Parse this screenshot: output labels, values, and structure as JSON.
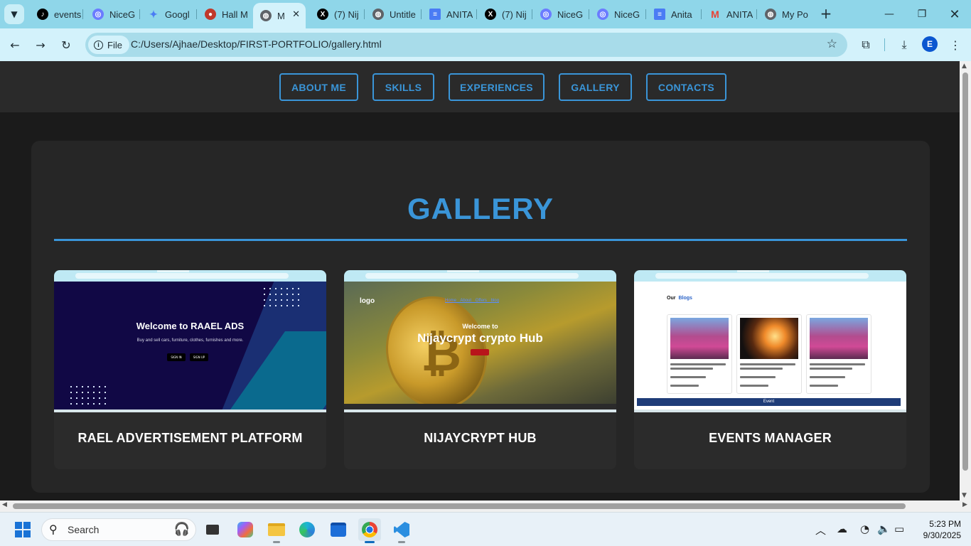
{
  "browser": {
    "tabs": [
      {
        "title": "events",
        "icon": "tiktok-icon",
        "color": "#000000"
      },
      {
        "title": "NiceG",
        "icon": "niceg-icon",
        "color": "#6b7cff"
      },
      {
        "title": "Googl",
        "icon": "gemini-icon",
        "color": "#4a7cf4"
      },
      {
        "title": "Hall M",
        "icon": "hall-icon",
        "color": "#c0392b"
      },
      {
        "title": "M",
        "icon": "globe-icon",
        "color": "#5f6368"
      },
      {
        "title": "(7) Nij",
        "icon": "x-icon",
        "color": "#000000"
      },
      {
        "title": "Untitle",
        "icon": "globe-icon",
        "color": "#5f6368"
      },
      {
        "title": "ANITA",
        "icon": "docs-icon",
        "color": "#4a7cf4"
      },
      {
        "title": "(7) Nij",
        "icon": "x-icon",
        "color": "#000000"
      },
      {
        "title": "NiceG",
        "icon": "niceg-icon",
        "color": "#6b7cff"
      },
      {
        "title": "NiceG",
        "icon": "niceg-icon",
        "color": "#6b7cff"
      },
      {
        "title": "Anita",
        "icon": "docs-icon",
        "color": "#4a7cf4"
      },
      {
        "title": "ANITA",
        "icon": "gmail-icon",
        "color": "#ea4335"
      },
      {
        "title": "My Po",
        "icon": "globe-icon",
        "color": "#5f6368"
      }
    ],
    "url_chip": "File",
    "url": "C:/Users/Ajhae/Desktop/FIRST-PORTFOLIO/gallery.html",
    "profile_initial": "E"
  },
  "page": {
    "nav": [
      "ABOUT ME",
      "SKILLS",
      "EXPERIENCES",
      "GALLERY",
      "CONTACTS"
    ],
    "gallery_title": "GALLERY",
    "cards": [
      {
        "caption": "RAEL ADVERTISEMENT PLATFORM",
        "shot_heading": "Welcome to RAAEL ADS",
        "shot_sub": "Buy and sell cars, furniture, clothes, furnishes and more.",
        "shot_buttons": [
          "SIGN IN",
          "SIGN UP"
        ]
      },
      {
        "caption": "NIJAYCRYPT HUB",
        "shot_logo": "logo",
        "shot_links": "Home About Offers blog",
        "shot_line1": "Welcome to",
        "shot_line2": "Nijaycrypt crypto Hub",
        "shot_symbol": "₿"
      },
      {
        "caption": "EVENTS MANAGER",
        "shot_our": "Our",
        "shot_blogs": "Blogs",
        "shot_bar": "Event"
      }
    ]
  },
  "taskbar": {
    "search_label": "Search",
    "time": "5:23 PM",
    "date": "9/30/2025"
  },
  "colors": {
    "accent": "#3a95d8",
    "page_bg": "#1b1b1b",
    "panel_bg": "#262626",
    "chrome": "#8fd6e9"
  }
}
